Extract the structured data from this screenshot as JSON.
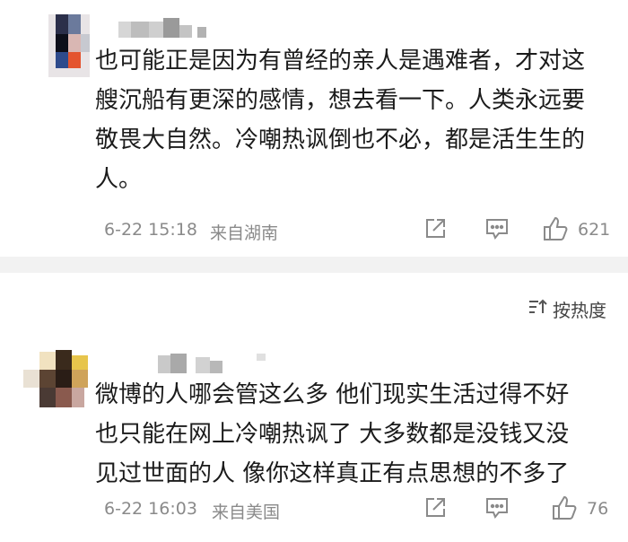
{
  "comments": [
    {
      "lines": [
        "也可能正是因为有曾经的亲人是遇难者，才对这",
        "艘沉船有更深的感情，想去看一下。人类永远要",
        "敬畏大自然。冷嘲热讽倒也不必，都是活生生的",
        "人。"
      ],
      "date": "6-22 15:18",
      "location": "来自湖南",
      "likes": "621"
    },
    {
      "lines": [
        "微博的人哪会管这么多 他们现实生活过得不好",
        "也只能在网上冷嘲热讽了 大多数都是没钱又没",
        "见过世面的人 像你这样真正有点思想的不多了"
      ],
      "date": "6-22 16:03",
      "location": "来自美国",
      "likes": "76"
    }
  ],
  "sort_label": "按热度",
  "icons": [
    "share-icon",
    "comment-icon",
    "like-icon",
    "sort-icon"
  ]
}
